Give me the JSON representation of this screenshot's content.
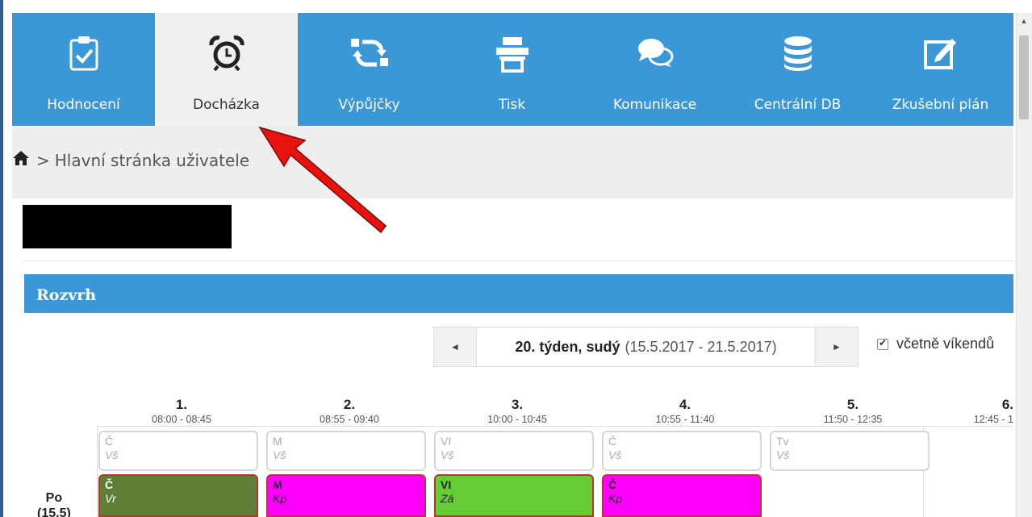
{
  "nav": {
    "items": [
      {
        "label": "Hodnocení",
        "icon": "clipboard-check-icon",
        "active": false
      },
      {
        "label": "Docházka",
        "icon": "alarm-clock-icon",
        "active": true
      },
      {
        "label": "Výpůjčky",
        "icon": "sync-icon",
        "active": false
      },
      {
        "label": "Tisk",
        "icon": "printer-icon",
        "active": false
      },
      {
        "label": "Komunikace",
        "icon": "chat-bubbles-icon",
        "active": false
      },
      {
        "label": "Centrální DB",
        "icon": "database-icon",
        "active": false
      },
      {
        "label": "Zkušební plán",
        "icon": "edit-icon",
        "active": false
      }
    ]
  },
  "breadcrumb": {
    "separator": ">",
    "label": "Hlavní stránka uživatele"
  },
  "panel": {
    "title": "Rozvrh"
  },
  "week": {
    "prev": "◄",
    "next": "►",
    "bold": "20. týden, sudý",
    "range": "(15.5.2017 - 21.5.2017)",
    "include_weekends_label": "včetně víkendů",
    "include_weekends_checked": true
  },
  "periods": [
    {
      "num": "1.",
      "time": "08:00 - 08:45"
    },
    {
      "num": "2.",
      "time": "08:55 - 09:40"
    },
    {
      "num": "3.",
      "time": "10:00 - 10:45"
    },
    {
      "num": "4.",
      "time": "10:55 - 11:40"
    },
    {
      "num": "5.",
      "time": "11:50 - 12:35"
    },
    {
      "num": "6.",
      "time": "12:45 - 1"
    }
  ],
  "day": {
    "name": "Po",
    "date": "(15.5)"
  },
  "planned": [
    {
      "subject": "Č",
      "teacher": "Vš"
    },
    {
      "subject": "M",
      "teacher": "Vš"
    },
    {
      "subject": "VI",
      "teacher": "Vš"
    },
    {
      "subject": "Č",
      "teacher": "Vš"
    },
    {
      "subject": "Tv",
      "teacher": "Vš"
    }
  ],
  "actual": [
    {
      "subject": "Č",
      "teacher": "Vr",
      "color": "#5e7f35"
    },
    {
      "subject": "M",
      "teacher": "Kp",
      "color": "#ff00ff"
    },
    {
      "subject": "VI",
      "teacher": "Zá",
      "color": "#66cc33"
    },
    {
      "subject": "Č",
      "teacher": "Kp",
      "color": "#ff00ff"
    }
  ],
  "colors": {
    "nav": "#3a97d8",
    "annotation_arrow": "#e8130f"
  }
}
